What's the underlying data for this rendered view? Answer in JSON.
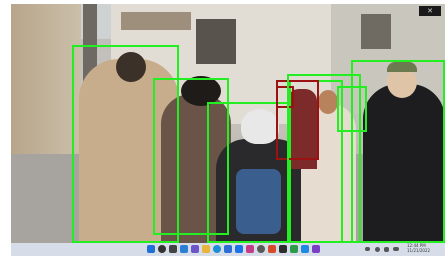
{
  "window": {
    "close_label": "✕"
  },
  "video": {
    "person_count": 8,
    "person_ids": [
      "person-1",
      "person-2",
      "person-3",
      "person-4",
      "person-5",
      "person-6",
      "person-7",
      "person-8"
    ],
    "alert_ids": [
      "alert-1"
    ],
    "box_color": "#22ee22",
    "alert_color": "#9c1111"
  },
  "taskbar": {
    "icons": [
      "windows-start-icon",
      "search-icon",
      "task-view-icon",
      "widgets-icon",
      "chat-icon",
      "file-explorer-icon",
      "edge-browser-icon",
      "store-icon",
      "mail-icon",
      "photos-icon",
      "settings-icon",
      "media-icon",
      "terminal-icon",
      "app-icon",
      "app-icon-2",
      "app-icon-3"
    ],
    "icon_colors": [
      "#1f6fd6",
      "#333333",
      "#444444",
      "#2a7fd4",
      "#6b55c9",
      "#e8b43a",
      "#1d8fd6",
      "#2b6fd6",
      "#1a73e8",
      "#c33c8a",
      "#5a5a5a",
      "#d64b2a",
      "#2d2d2d",
      "#2c9c4a",
      "#1e88e5",
      "#7a3fc7"
    ],
    "time": "12:44 PM",
    "date": "11/21/2022"
  }
}
